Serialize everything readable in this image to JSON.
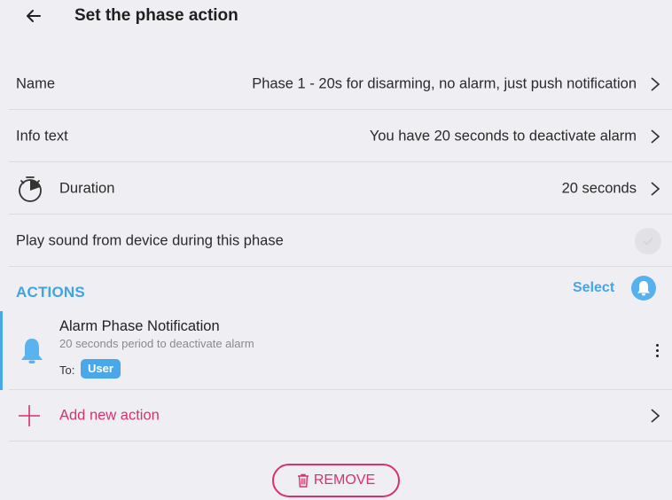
{
  "header": {
    "title": "Set the phase action",
    "back_icon": "arrow-left-icon"
  },
  "settings": {
    "name": {
      "label": "Name",
      "value": "Phase 1 - 20s for disarming, no alarm, just push notification"
    },
    "info_text": {
      "label": "Info text",
      "value": "You have 20 seconds to deactivate alarm"
    },
    "duration": {
      "label": "Duration",
      "value": "20 seconds",
      "icon": "timer-icon"
    },
    "play_sound": {
      "label": "Play sound from device during this phase",
      "checked": false
    }
  },
  "actions": {
    "heading": "ACTIONS",
    "select_label": "Select",
    "items": [
      {
        "title": "Alarm Phase Notification",
        "subtitle": "20 seconds period to deactivate alarm",
        "to_label": "To:",
        "recipient": "User",
        "icon": "bell-icon"
      }
    ],
    "add_label": "Add new action"
  },
  "footer": {
    "remove_label": "REMOVE"
  },
  "colors": {
    "background": "#efeef2",
    "accent_blue": "#4aa8ea",
    "accent_pink": "#d6336c"
  }
}
